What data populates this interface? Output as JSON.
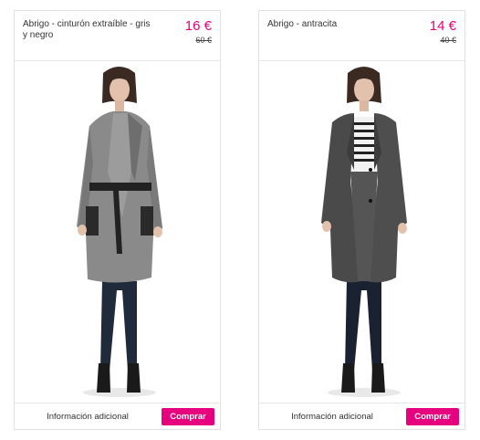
{
  "products": [
    {
      "title": "Abrigo - cinturón extraíble - gris y negro",
      "price": "16 €",
      "old_price": "60 €",
      "info_label": "Información adicional",
      "buy_label": "Comprar"
    },
    {
      "title": "Abrigo - antracita",
      "price": "14 €",
      "old_price": "40 €",
      "info_label": "Información adicional",
      "buy_label": "Comprar"
    }
  ],
  "colors": {
    "accent": "#e6007e",
    "border": "#e1e1e1"
  }
}
